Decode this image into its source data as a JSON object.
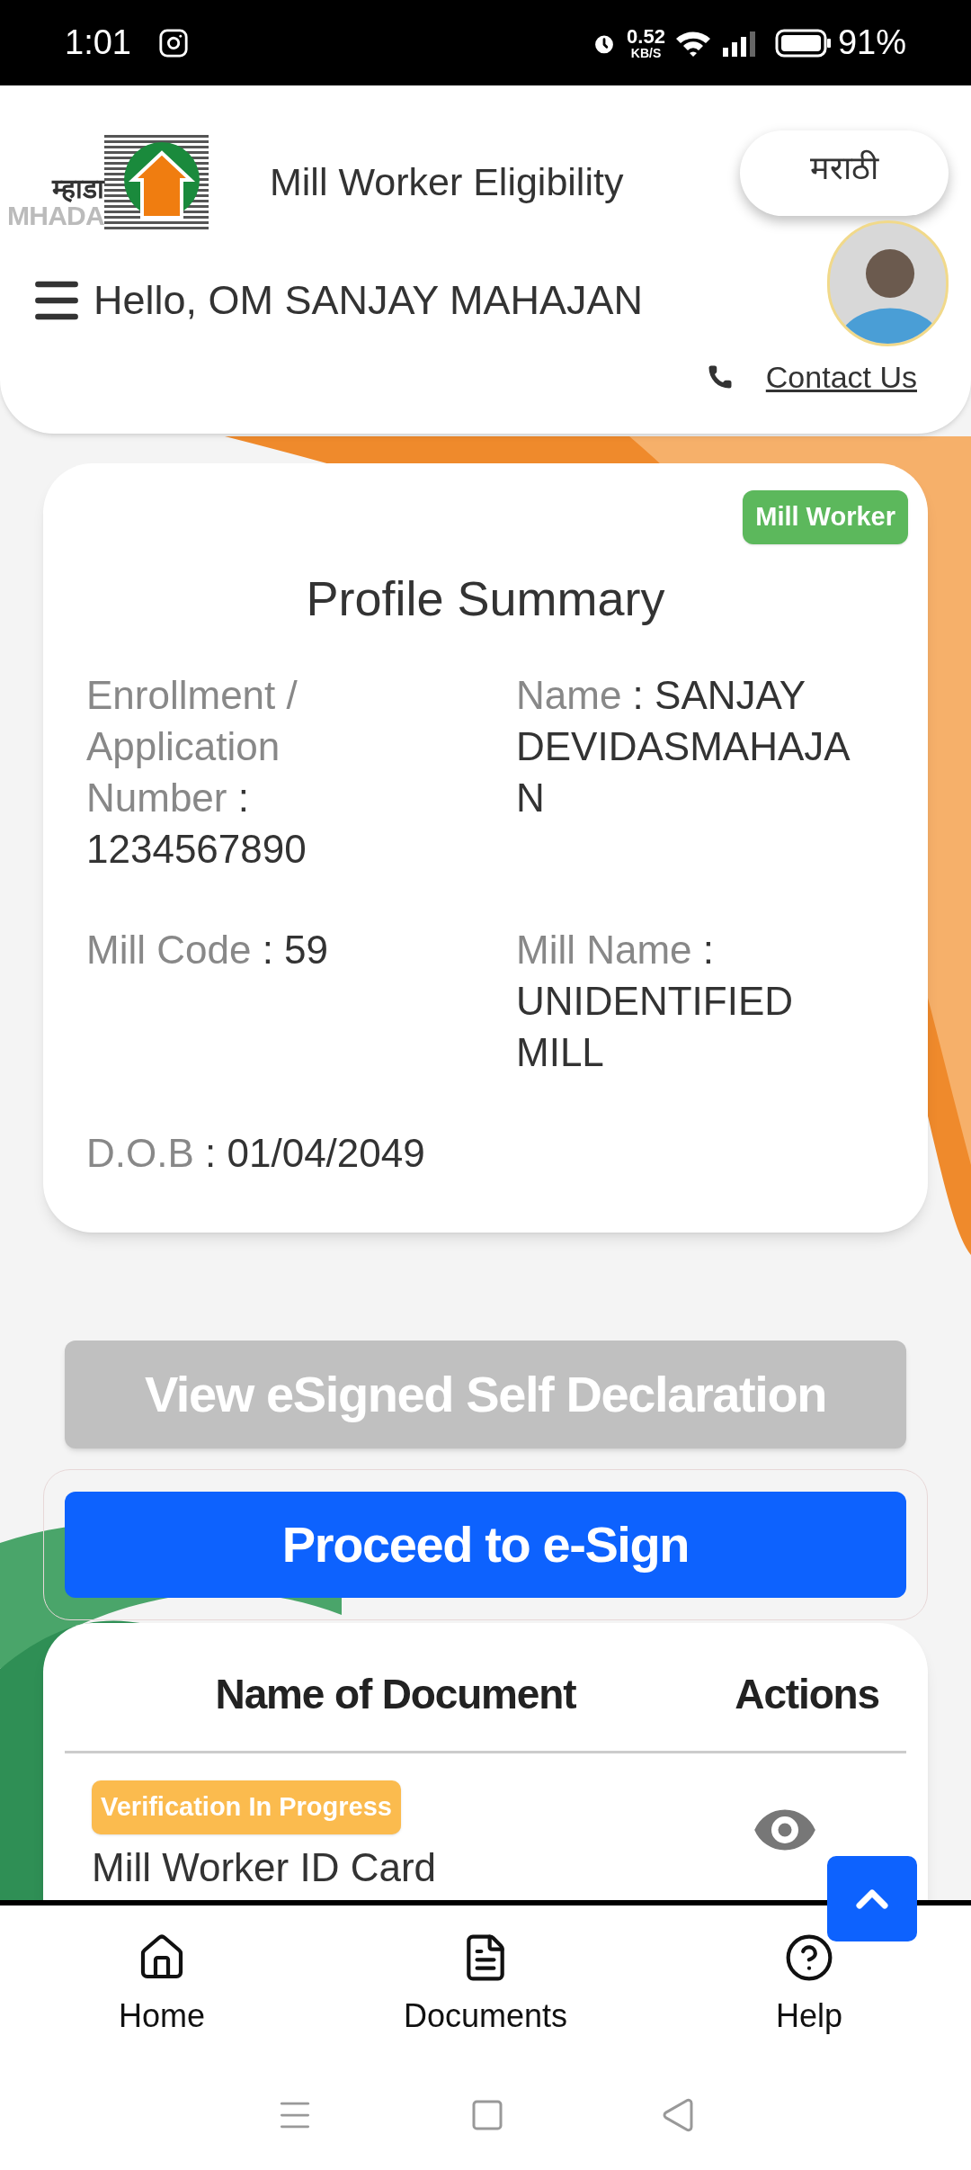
{
  "status_bar": {
    "time": "1:01",
    "network_speed": "0.52",
    "network_unit": "KB/S",
    "battery": "91%"
  },
  "header": {
    "logo_devanagari": "म्हाडा",
    "logo_latin": "MHADA",
    "title": "Mill Worker Eligibility",
    "language_button": "मराठी",
    "greeting": "Hello, OM SANJAY MAHAJAN",
    "contact": "Contact Us"
  },
  "profile": {
    "badge": "Mill Worker",
    "title": "Profile Summary",
    "separator": ":",
    "fields": [
      {
        "label": "Enrollment / Application Number",
        "value": "1234567890"
      },
      {
        "label": "Name",
        "value": "SANJAY DEVIDASMAHAJAN"
      },
      {
        "label": "Mill Code",
        "value": "59"
      },
      {
        "label": "Mill Name",
        "value": "UNIDENTIFIED MILL"
      },
      {
        "label": "D.O.B",
        "value": "01/04/2049"
      }
    ]
  },
  "actions": [
    {
      "label": "View eSigned Self Declaration",
      "disabled": true
    },
    {
      "label": "Proceed to e-Sign",
      "disabled": false
    }
  ],
  "documents": {
    "columns": [
      "Name of Document",
      "Actions"
    ],
    "rows": [
      {
        "status": "Verification In Progress",
        "name": "Mill Worker ID Card"
      }
    ]
  },
  "bottom_nav": [
    {
      "kind": "home",
      "label": "Home"
    },
    {
      "kind": "document",
      "label": "Documents"
    },
    {
      "kind": "help",
      "label": "Help"
    }
  ]
}
